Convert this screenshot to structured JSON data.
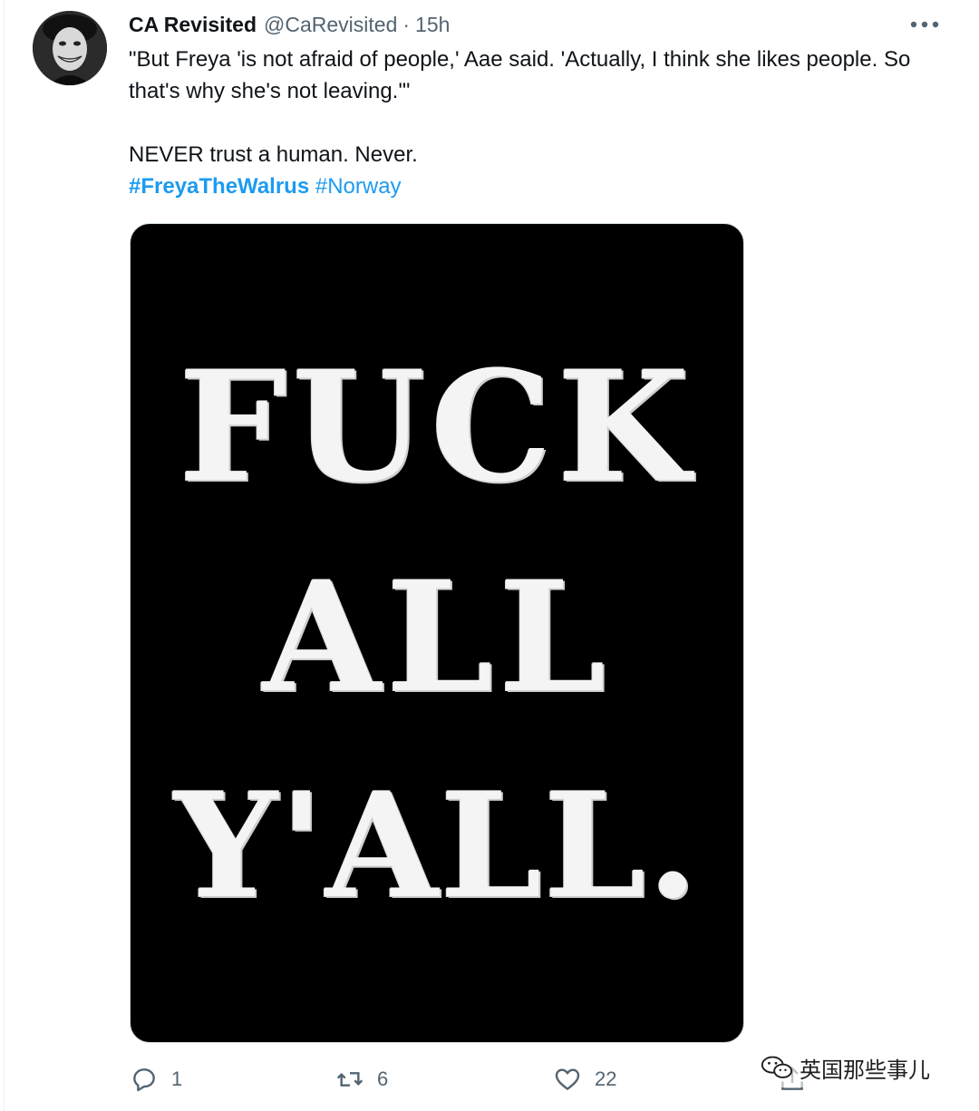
{
  "tweet": {
    "author_name": "CA Revisited",
    "author_handle": "@CaRevisited",
    "separator": "·",
    "time": "15h",
    "text_line1": "\"But Freya 'is not afraid of people,' Aae said. 'Actually, I think she likes people. So that's why she's not leaving.'\"",
    "text_line2": "NEVER trust a human. Never.",
    "hashtags": [
      "#FreyaTheWalrus",
      "#Norway"
    ],
    "media_lines": [
      "FUCK",
      "ALL",
      "Y'ALL."
    ]
  },
  "actions": {
    "reply_count": "1",
    "retweet_count": "6",
    "like_count": "22"
  },
  "icons": {
    "more": "more-dots-icon",
    "reply": "reply-bubble-icon",
    "retweet": "retweet-arrows-icon",
    "like": "heart-icon",
    "share": "share-upload-icon",
    "watermark": "wechat-icon"
  },
  "watermark_text": "英国那些事儿",
  "colors": {
    "accent": "#1d9bf0",
    "secondary_text": "#536471",
    "primary_text": "#0f1419"
  }
}
